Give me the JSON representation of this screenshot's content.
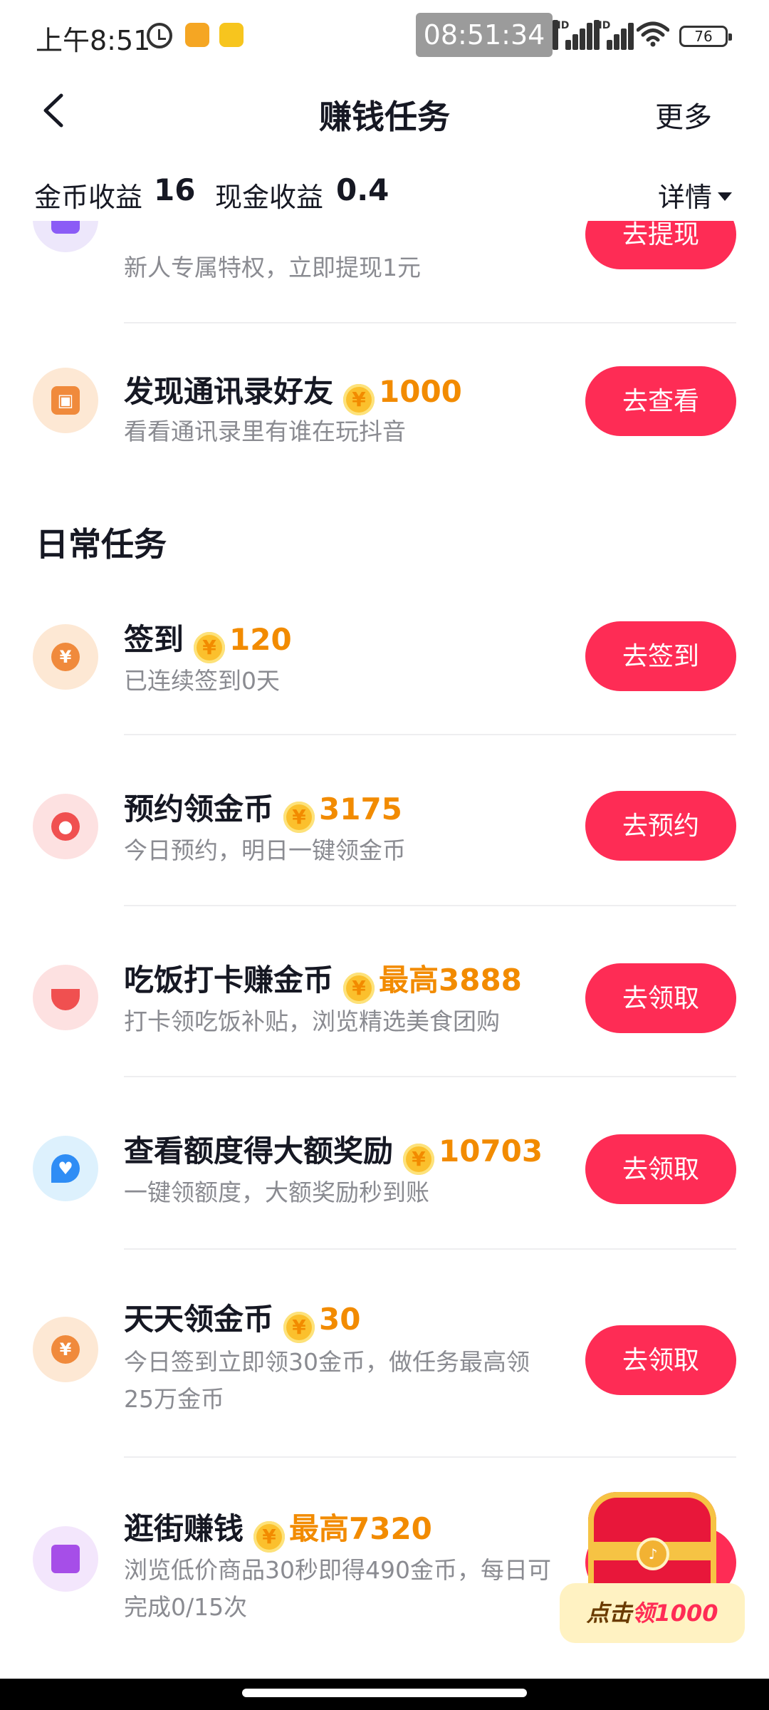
{
  "status_bar": {
    "time": "上午8:51",
    "clock_overlay": "08:51:34",
    "hd1": "HD",
    "hd2": "HD",
    "battery": "76"
  },
  "nav": {
    "title": "赚钱任务",
    "more": "更多"
  },
  "earnings": {
    "coin_label": "金币收益",
    "coin_value": "16",
    "cash_label": "现金收益",
    "cash_value": "0.4",
    "detail": "详情"
  },
  "coin_symbol": "¥",
  "tasks_top": [
    {
      "title": "",
      "desc": "新人专属特权，立即提现1元",
      "button": "去提现"
    },
    {
      "title": "发现通讯录好友",
      "reward": "1000",
      "desc": "看看通讯录里有谁在玩抖音",
      "button": "去查看"
    }
  ],
  "daily_section": {
    "title": "日常任务"
  },
  "daily_tasks": [
    {
      "title": "签到",
      "reward": "120",
      "desc": "已连续签到0天",
      "button": "去签到"
    },
    {
      "title": "预约领金币",
      "reward": "3175",
      "desc": "今日预约，明日一键领金币",
      "button": "去预约"
    },
    {
      "title": "吃饭打卡赚金币",
      "reward": "最高3888",
      "desc": "打卡领吃饭补贴，浏览精选美食团购",
      "button": "去领取"
    },
    {
      "title": "查看额度得大额奖励",
      "reward": "10703",
      "desc": "一键领额度，大额奖励秒到账",
      "button": "去领取"
    },
    {
      "title": "天天领金币",
      "reward": "30",
      "desc": "今日签到立即领30金币，做任务最高领25万金币",
      "button": "去领取"
    },
    {
      "title": "逛街赚钱",
      "reward": "最高7320",
      "desc": "浏览低价商品30秒即得490金币，每日可完成0/15次",
      "button": ""
    }
  ],
  "floating": {
    "prefix": "点击",
    "highlight": "领1000"
  },
  "colors": {
    "accent": "#fe2c55",
    "reward": "#f28b00"
  }
}
